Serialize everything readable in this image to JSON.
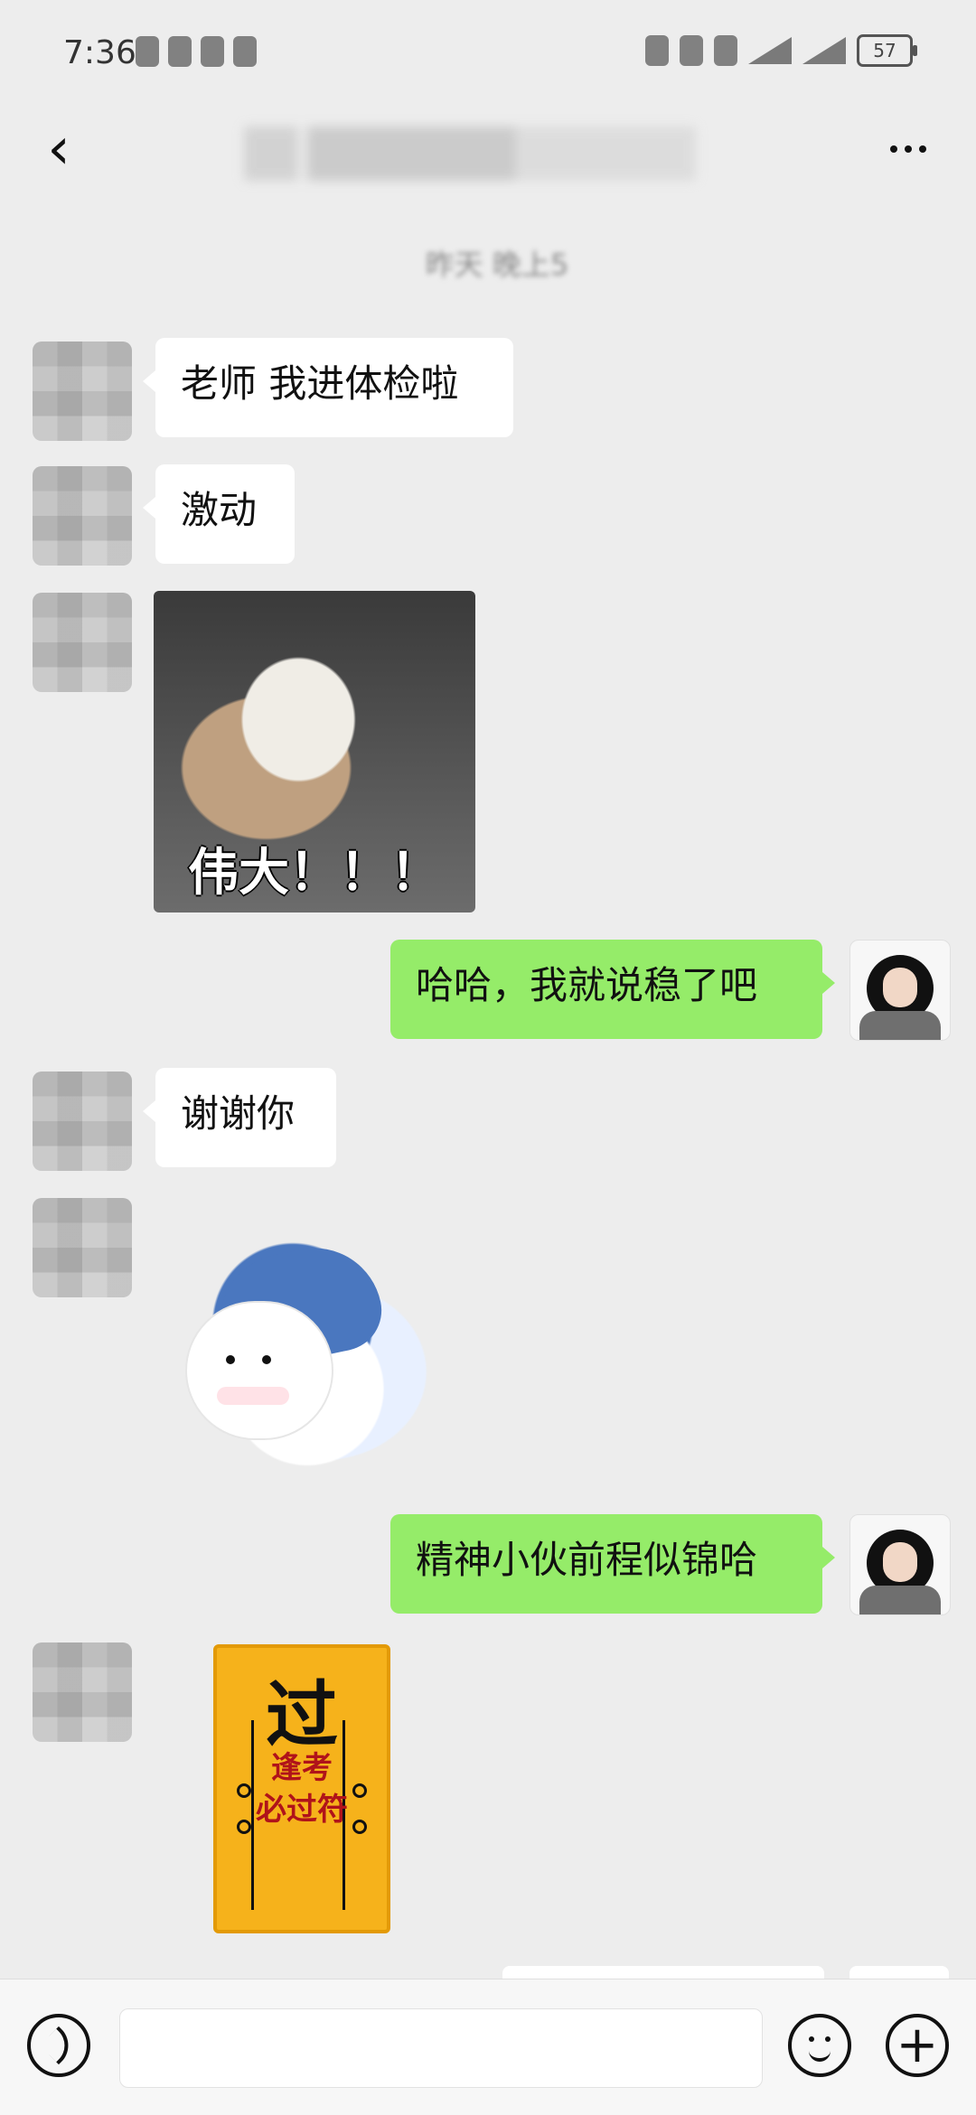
{
  "status_bar": {
    "time": "7:36",
    "battery": "57"
  },
  "header": {
    "title": ""
  },
  "chat": {
    "timestamp": "昨天 晚上5",
    "messages": [
      {
        "side": "left",
        "text": "老师 我进体检啦"
      },
      {
        "side": "left",
        "text": "激动"
      },
      {
        "side": "left",
        "type": "sticker",
        "caption": "伟大！！！"
      },
      {
        "side": "right",
        "text": "哈哈，我就说稳了吧"
      },
      {
        "side": "left",
        "text": "谢谢你"
      },
      {
        "side": "left",
        "type": "sticker",
        "caption": ""
      },
      {
        "side": "right",
        "text": "精神小伙前程似锦哈"
      },
      {
        "side": "left",
        "type": "charm",
        "title": "过",
        "text": "逢考\n必过符"
      }
    ]
  }
}
